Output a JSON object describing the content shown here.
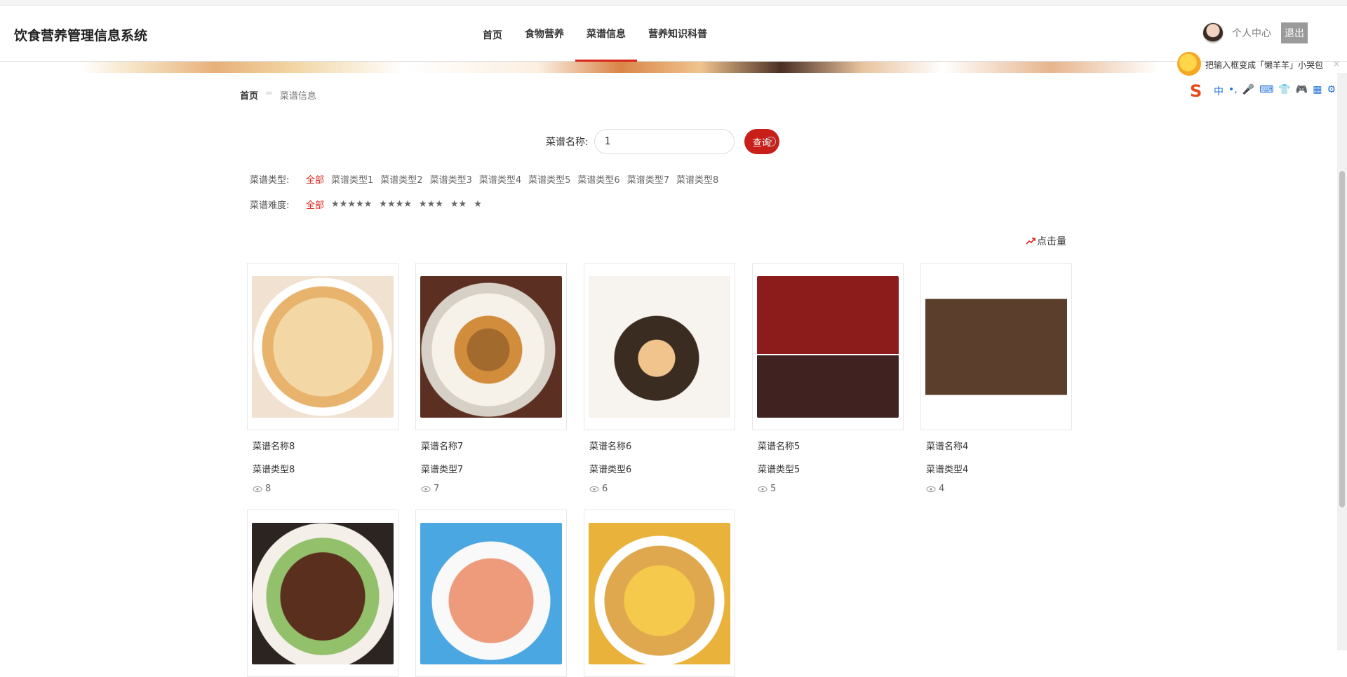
{
  "app": {
    "title": "饮食营养管理信息系统"
  },
  "nav": [
    {
      "label": "首页",
      "active": false
    },
    {
      "label": "食物营养",
      "active": false
    },
    {
      "label": "菜谱信息",
      "active": true
    },
    {
      "label": "营养知识科普",
      "active": false
    }
  ],
  "user": {
    "center_label": "个人中心",
    "logout_label": "退出"
  },
  "ime": {
    "tip": "把输入框变成「懒羊羊」小哭包",
    "close": "×",
    "logo": "S",
    "icons": [
      "中",
      "•,",
      "🎤",
      "⌨",
      "👕",
      "🎮",
      "▦",
      "⚙"
    ]
  },
  "breadcrumb": {
    "home": "首页",
    "separator": "=",
    "current": "菜谱信息"
  },
  "search": {
    "label": "菜谱名称:",
    "value": "1",
    "button": "查询"
  },
  "filters": {
    "type": {
      "label": "菜谱类型:",
      "options": [
        "全部",
        "菜谱类型1",
        "菜谱类型2",
        "菜谱类型3",
        "菜谱类型4",
        "菜谱类型5",
        "菜谱类型6",
        "菜谱类型7",
        "菜谱类型8"
      ],
      "selected": "全部"
    },
    "difficulty": {
      "label": "菜谱难度:",
      "options": [
        "全部",
        "★★★★★",
        "★★★★",
        "★★★",
        "★★",
        "★"
      ],
      "selected": "全部"
    }
  },
  "sort": {
    "label": "点击量",
    "icon": "trend-up-icon"
  },
  "recipes": [
    {
      "name": "菜谱名称8",
      "type": "菜谱类型8",
      "views": "8",
      "image": "flatbread-burger"
    },
    {
      "name": "菜谱名称7",
      "type": "菜谱类型7",
      "views": "7",
      "image": "soup-bowl"
    },
    {
      "name": "菜谱名称6",
      "type": "菜谱类型6",
      "views": "6",
      "image": "pork-belly"
    },
    {
      "name": "菜谱名称5",
      "type": "菜谱类型5",
      "views": "5",
      "image": "bbq-beef"
    },
    {
      "name": "菜谱名称4",
      "type": "菜谱类型4",
      "views": "4",
      "image": "grilled-steak"
    },
    {
      "name": "",
      "type": "",
      "views": "",
      "image": "braised-pork"
    },
    {
      "name": "",
      "type": "",
      "views": "",
      "image": "shrimp"
    },
    {
      "name": "",
      "type": "",
      "views": "",
      "image": "egg-onion"
    }
  ],
  "colors": {
    "accent": "#d9251c",
    "button": "#c81f1a"
  }
}
